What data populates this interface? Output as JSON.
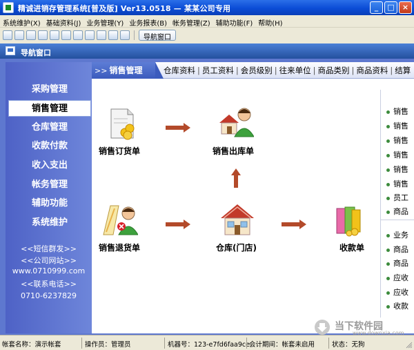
{
  "window": {
    "title": "精诚进销存管理系统[普及版] Ver13.0518 — 某某公司专用",
    "buttons": [
      "_",
      "□",
      "×"
    ]
  },
  "menu": [
    "系统维护(X)",
    "基础资料(J)",
    "业务管理(Y)",
    "业务报表(B)",
    "帐务管理(Z)",
    "辅助功能(F)",
    "帮助(H)"
  ],
  "toolbar": {
    "nav_button": "导航窗口"
  },
  "nav": {
    "title": "导航窗口"
  },
  "sidebar": {
    "items": [
      "采购管理",
      "销售管理",
      "仓库管理",
      "收款付款",
      "收入支出",
      "帐务管理",
      "辅助功能",
      "系统维护"
    ],
    "active": "销售管理",
    "links": [
      "<<短信群发>>",
      "<<公司网站>>",
      "www.0710999.com",
      "<<联系电话>>",
      "0710-6237829"
    ]
  },
  "tabs": {
    "prefix": ">>",
    "current": "销售管理",
    "links": [
      "仓库资料",
      "员工资料",
      "会员级别",
      "往来单位",
      "商品类别",
      "商品资料",
      "结算"
    ]
  },
  "flow": {
    "nodes": [
      "销售订货单",
      "销售出库单",
      "销售退货单",
      "仓库(门店)",
      "收款单"
    ]
  },
  "right_panel": {
    "group1": [
      "销售",
      "销售",
      "销售",
      "销售",
      "销售",
      "销售",
      "员工",
      "商品"
    ],
    "group2": [
      "业务",
      "商品",
      "商品",
      "应收",
      "应收",
      "收款"
    ]
  },
  "status": {
    "account": "帐套名称：演示帐套",
    "operator": "操作员：管理员",
    "machine": "机器号：123-e7fd6faa9ce",
    "period": "会计期间：帐套未启用",
    "state": "状态：无狗"
  },
  "watermark": {
    "name": "当下软件园",
    "url": "www.downxia.com"
  },
  "colors": {
    "sidebar": "#5E78CF",
    "titlebar": "#0B4CD6",
    "arrow": "#B34A2A"
  }
}
